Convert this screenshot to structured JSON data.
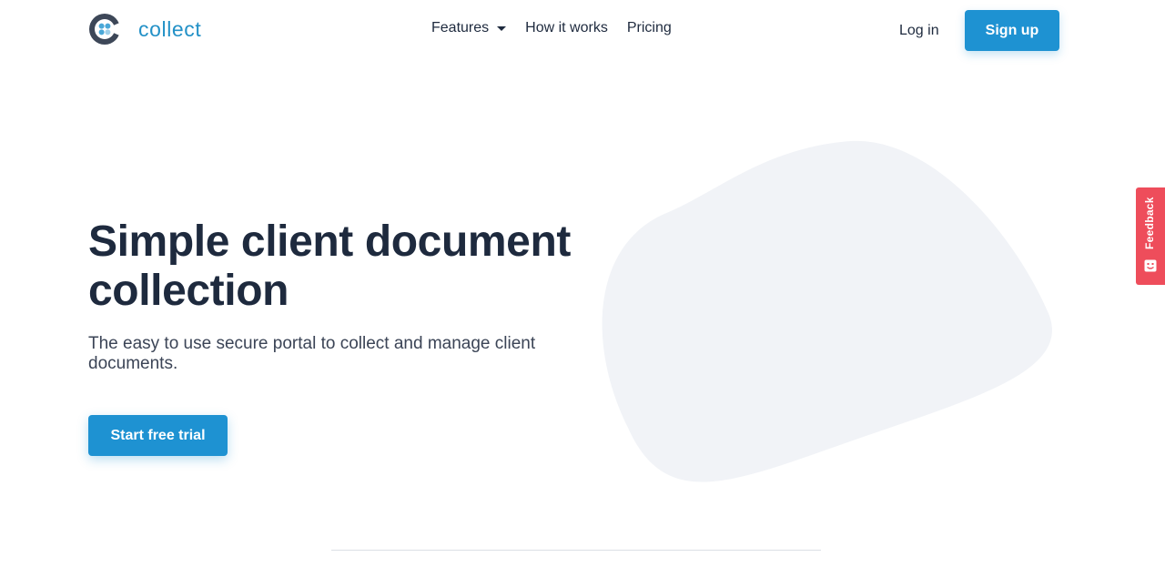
{
  "header": {
    "brand_name": "collect",
    "nav": {
      "features": "Features",
      "how_it_works": "How it works",
      "pricing": "Pricing"
    },
    "login": "Log in",
    "signup": "Sign up"
  },
  "hero": {
    "title": "Simple client document collection",
    "subtitle": "The easy to use secure portal to collect and manage client documents.",
    "cta": "Start free trial"
  },
  "feedback": {
    "label": "Feedback"
  },
  "icons": {
    "logo": "collect-logo-icon",
    "features_dropdown": "caret-down-icon",
    "feedback": "smile-icon"
  },
  "colors": {
    "primary": "#1e92d2",
    "brand_text": "#2391c7",
    "heading": "#1e2a3e",
    "blob": "#f1f3f7",
    "feedback": "#ee4d5b"
  }
}
